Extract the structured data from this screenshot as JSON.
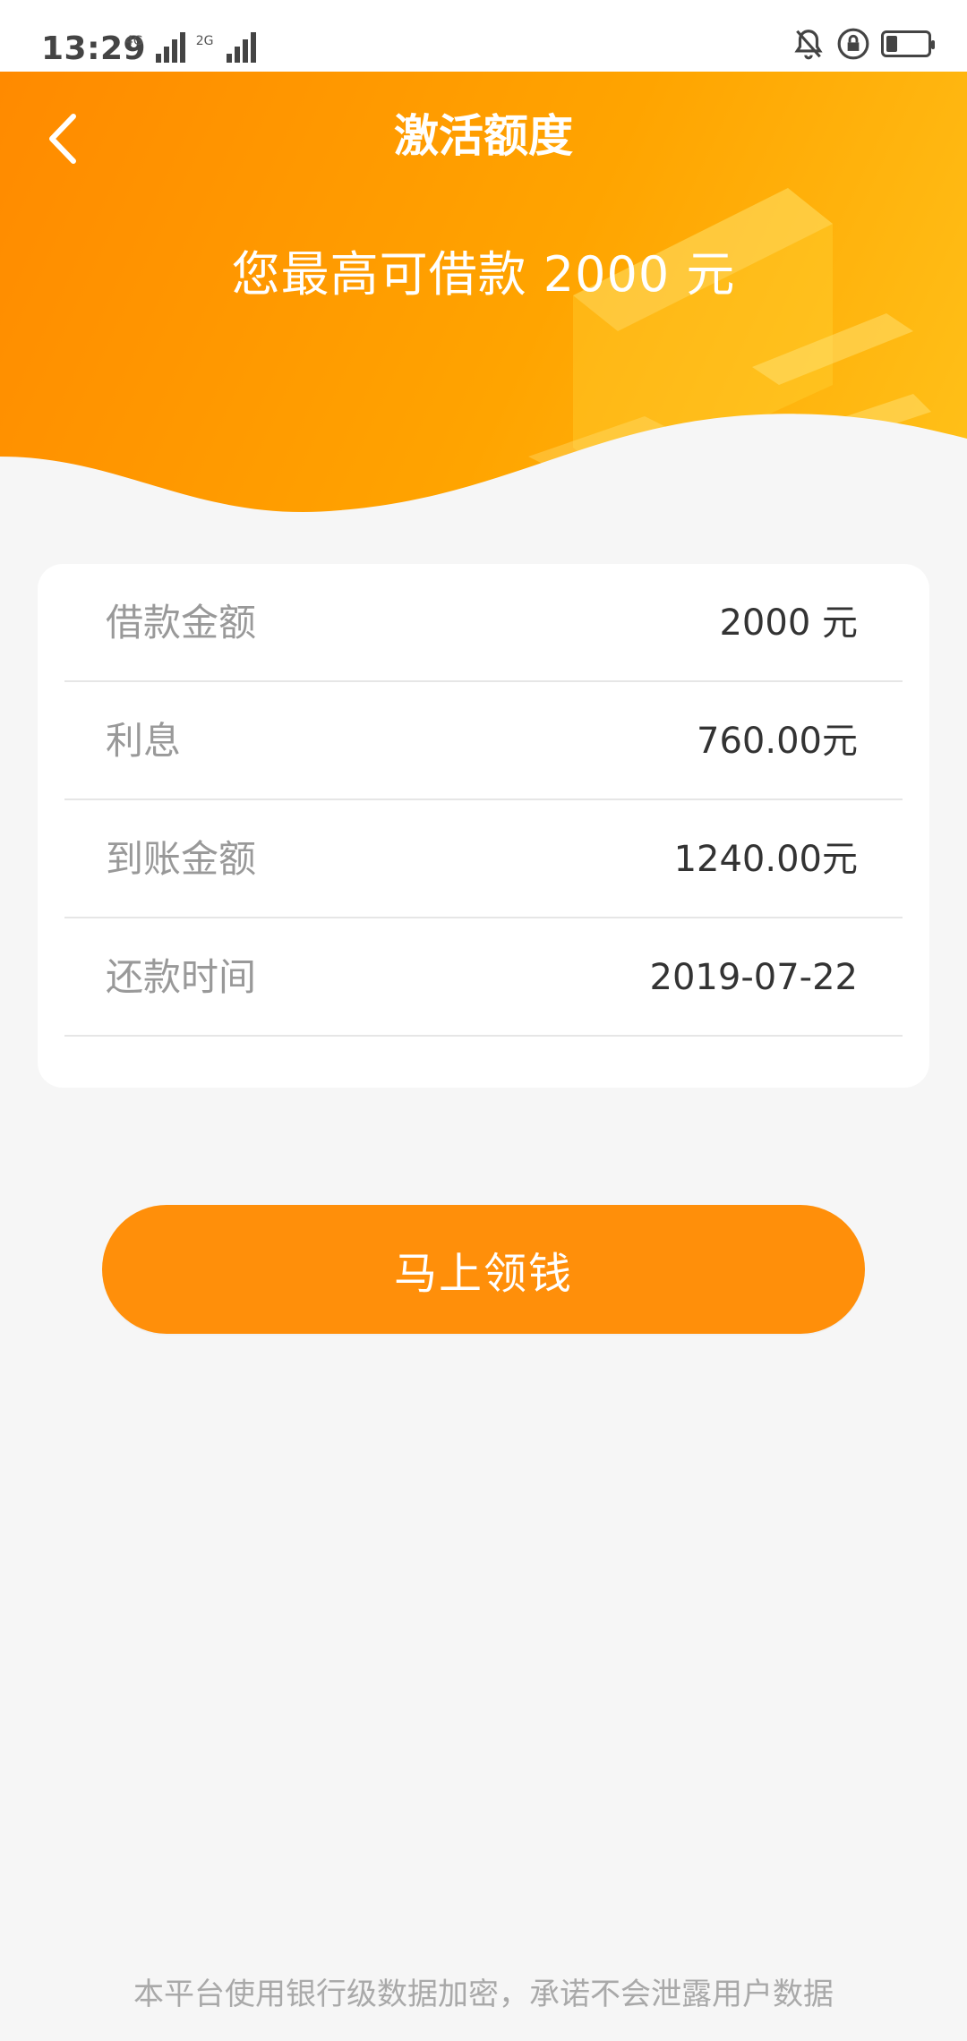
{
  "status_bar": {
    "time": "13:29",
    "network_1": "4G",
    "network_2": "2G",
    "icons": [
      "bell-off-icon",
      "screen-lock-icon",
      "battery-icon"
    ]
  },
  "header": {
    "title": "激活额度",
    "headline": "您最高可借款 2000 元",
    "back_icon": "chevron-left-icon",
    "gradient_colors": [
      "#ff8a00",
      "#ffc21a"
    ]
  },
  "details": {
    "rows": [
      {
        "label": "借款金额",
        "value": "2000 元"
      },
      {
        "label": "利息",
        "value": "760.00元"
      },
      {
        "label": "到账金额",
        "value": "1240.00元"
      },
      {
        "label": "还款时间",
        "value": "2019-07-22"
      }
    ]
  },
  "cta": {
    "label": "马上领钱",
    "color": "#ff8f0a"
  },
  "footer": {
    "note": "本平台使用银行级数据加密，承诺不会泄露用户数据"
  }
}
